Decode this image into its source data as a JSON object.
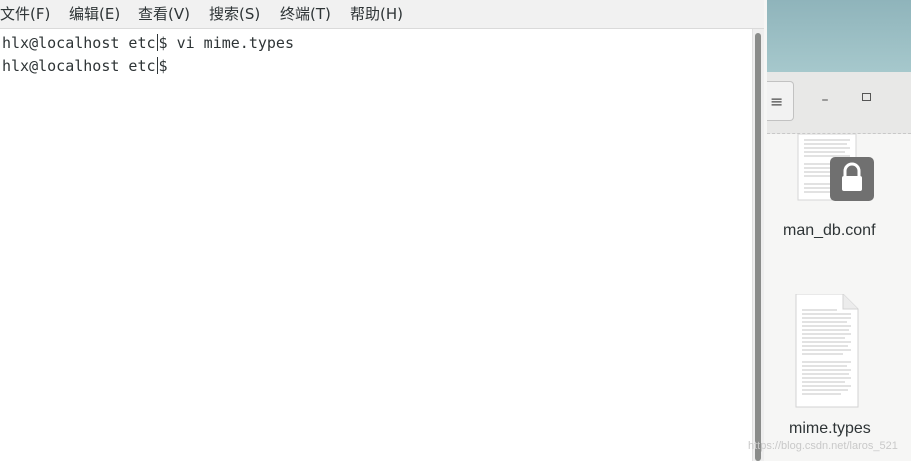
{
  "terminal": {
    "menu": [
      {
        "label": "文件(F)"
      },
      {
        "label": "编辑(E)"
      },
      {
        "label": "查看(V)"
      },
      {
        "label": "搜索(S)"
      },
      {
        "label": "终端(T)"
      },
      {
        "label": "帮助(H)"
      }
    ],
    "lines": [
      {
        "prompt": "hlx@localhost etc",
        "symbol": "$",
        "command": " vi mime.types"
      },
      {
        "prompt": "hlx@localhost etc",
        "symbol": "$",
        "command": ""
      }
    ]
  },
  "file_manager": {
    "menu_icon": "hamburger-menu-icon",
    "minimize_icon": "minimize-icon",
    "maximize_icon": "maximize-icon",
    "files": [
      {
        "name": "man_db.conf",
        "icon": "text-document-icon",
        "badge": "lock-icon"
      },
      {
        "name": "mime.types",
        "icon": "text-document-icon"
      }
    ]
  },
  "watermark": "https://blog.csdn.net/laros_521",
  "colors": {
    "menubar_bg": "#f1f1f1",
    "terminal_text": "#2e3436",
    "desktop_bg": "#9dbfc4",
    "lock_badge": "#6e6e6e"
  }
}
